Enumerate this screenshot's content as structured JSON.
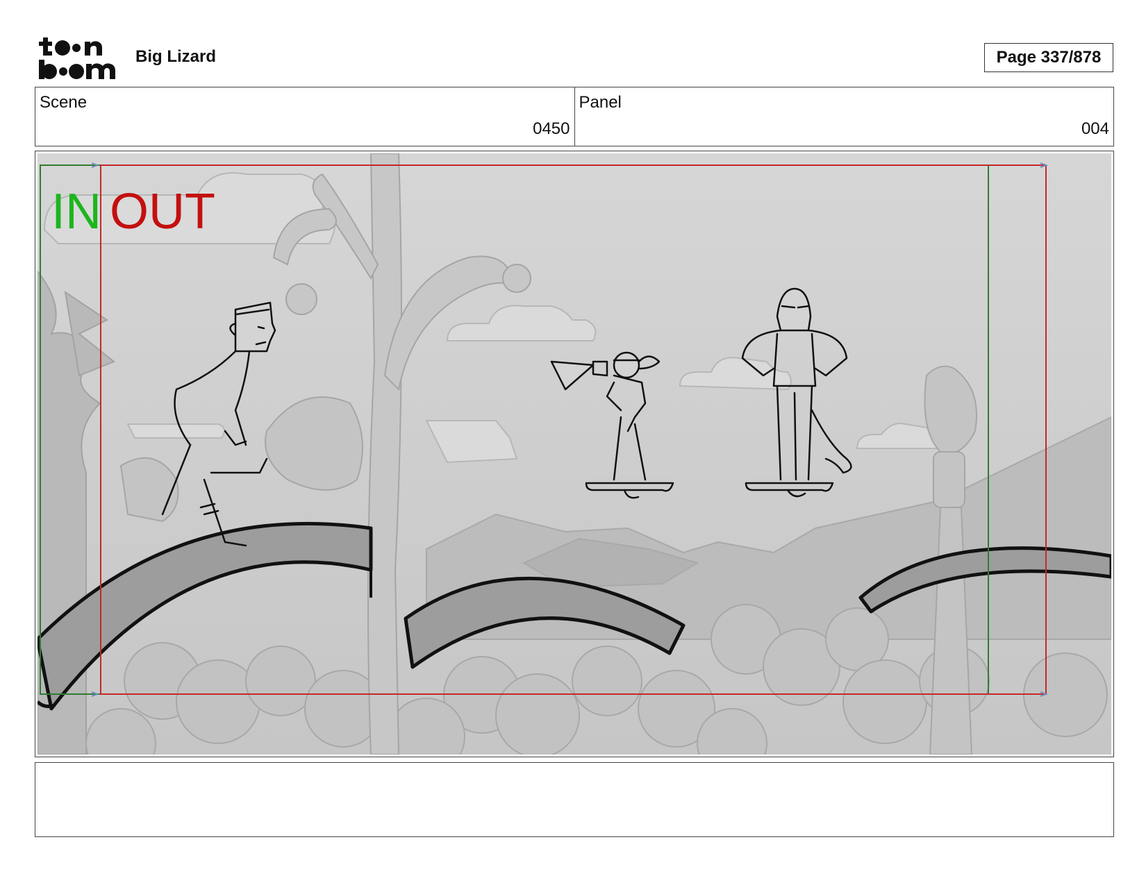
{
  "header": {
    "logo_text_top": "toon",
    "logo_text_bottom": "boom",
    "project_title": "Big Lizard",
    "page_label": "Page 337/878"
  },
  "info": {
    "scene_label": "Scene",
    "scene_value": "0450",
    "panel_label": "Panel",
    "panel_value": "004"
  },
  "panel": {
    "in_label": "IN",
    "out_label": "OUT",
    "colors": {
      "in_frame": "#2e7d32",
      "out_frame": "#c62828",
      "in_text": "#1db51d",
      "out_text": "#c40f0f",
      "background": "#cfcfcf"
    }
  },
  "notes": {
    "text": ""
  }
}
